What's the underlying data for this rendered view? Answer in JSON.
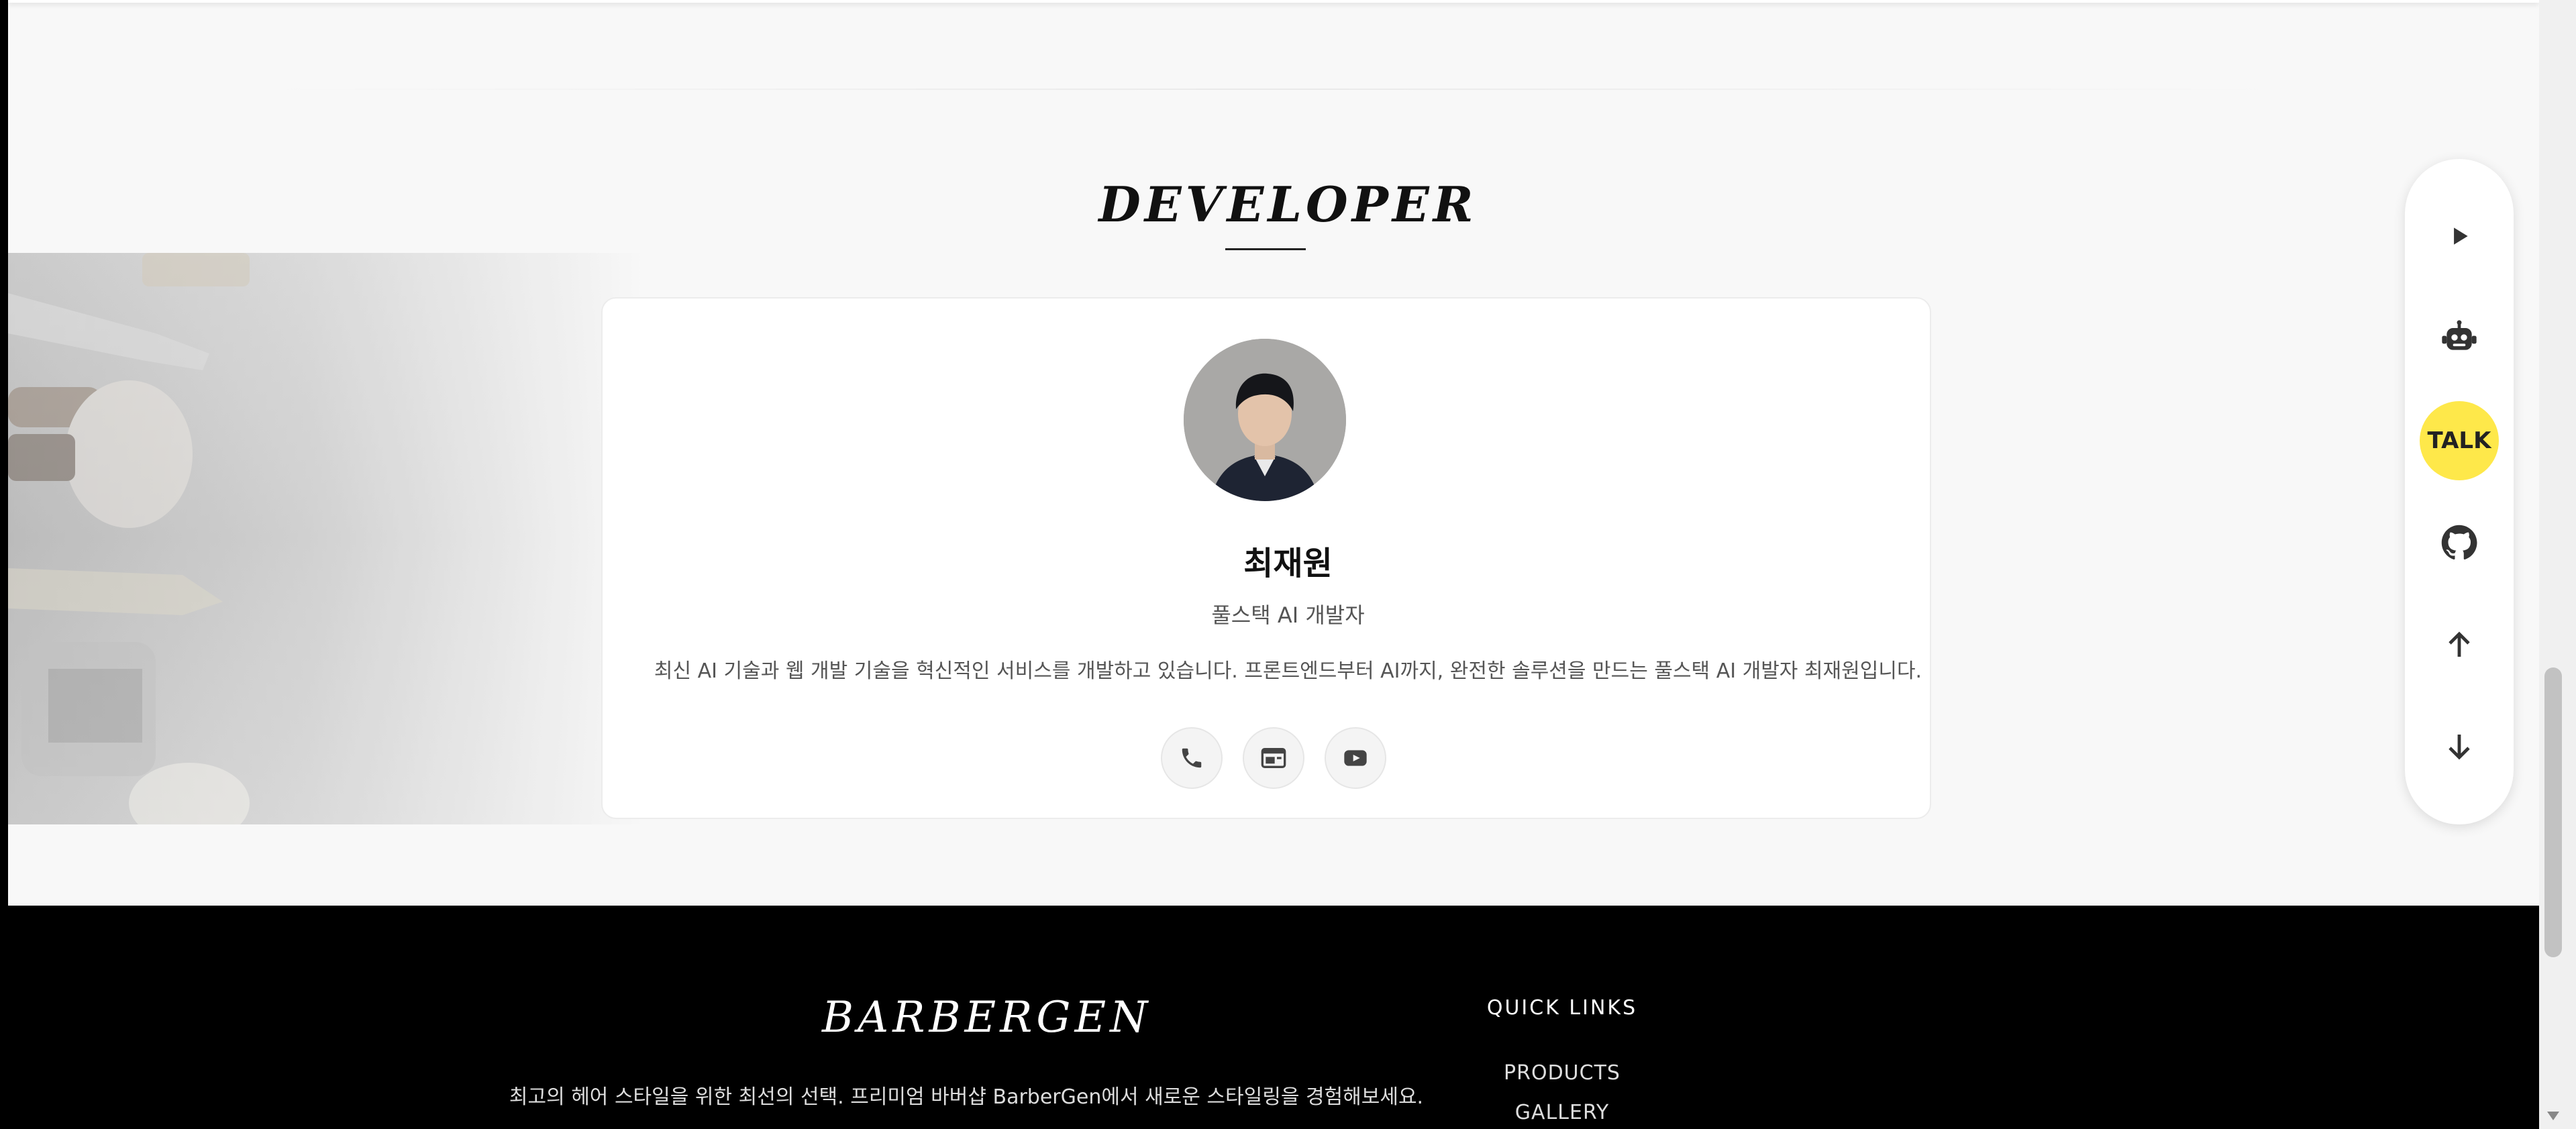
{
  "developer_section": {
    "title": "DEVELOPER",
    "name": "최재원",
    "role": "풀스택 AI 개발자",
    "description": "최신 AI 기술과 웹 개발 기술을 혁신적인 서비스를 개발하고 있습니다. 프론트엔드부터 AI까지, 완전한 솔루션을 만드는 풀스택 AI 개발자 최재원입니다.",
    "contacts": [
      {
        "icon": "phone-icon"
      },
      {
        "icon": "website-icon"
      },
      {
        "icon": "youtube-icon"
      }
    ]
  },
  "floating_bar": {
    "buttons": [
      {
        "icon": "play-icon"
      },
      {
        "icon": "robot-icon"
      },
      {
        "icon": "talk-icon",
        "label": "TALK"
      },
      {
        "icon": "github-icon"
      },
      {
        "icon": "arrow-up-icon"
      },
      {
        "icon": "arrow-down-icon"
      }
    ],
    "talk_color": "#fee84a"
  },
  "footer": {
    "brand": "BARBERGEN",
    "tagline": "최고의 헤어 스타일을 위한 최선의 선택. 프리미엄 바버샵 BarberGen에서 새로운 스타일링을 경험해보세요.",
    "quick_links_title": "QUICK LINKS",
    "quick_links": [
      "PRODUCTS",
      "GALLERY"
    ]
  },
  "colors": {
    "page_background": "#f8f8f8",
    "footer_background": "#000000",
    "accent_yellow": "#fee84a"
  }
}
